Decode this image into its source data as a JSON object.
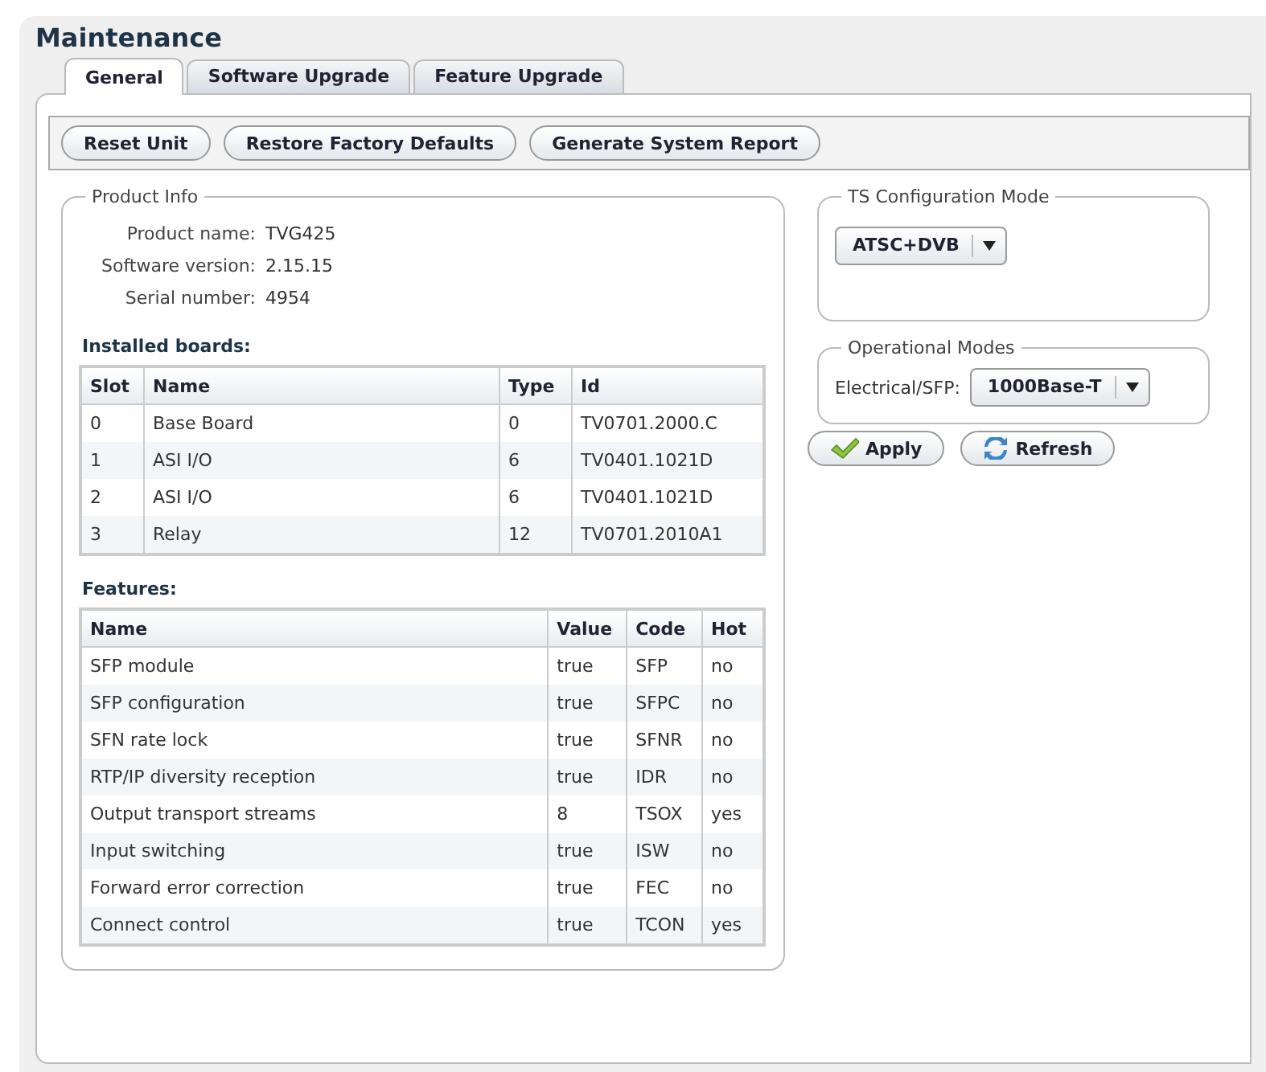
{
  "title": "Maintenance",
  "tabs": [
    {
      "label": "General",
      "selected": true
    },
    {
      "label": "Software Upgrade",
      "selected": false
    },
    {
      "label": "Feature Upgrade",
      "selected": false
    }
  ],
  "toolbar": [
    "Reset Unit",
    "Restore Factory Defaults",
    "Generate System Report"
  ],
  "product_info": {
    "legend": "Product Info",
    "fields": [
      {
        "label": "Product name:",
        "value": "TVG425"
      },
      {
        "label": "Software version:",
        "value": "2.15.15"
      },
      {
        "label": "Serial number:",
        "value": "4954"
      }
    ],
    "boards": {
      "heading": "Installed boards:",
      "columns": [
        "Slot",
        "Name",
        "Type",
        "Id"
      ],
      "rows": [
        [
          "0",
          "Base Board",
          "0",
          "TV0701.2000.C"
        ],
        [
          "1",
          "ASI I/O",
          "6",
          "TV0401.1021D"
        ],
        [
          "2",
          "ASI I/O",
          "6",
          "TV0401.1021D"
        ],
        [
          "3",
          "Relay",
          "12",
          "TV0701.2010A1"
        ]
      ]
    },
    "features": {
      "heading": "Features:",
      "columns": [
        "Name",
        "Value",
        "Code",
        "Hot"
      ],
      "rows": [
        [
          "SFP module",
          "true",
          "SFP",
          "no"
        ],
        [
          "SFP configuration",
          "true",
          "SFPC",
          "no"
        ],
        [
          "SFN rate lock",
          "true",
          "SFNR",
          "no"
        ],
        [
          "RTP/IP diversity reception",
          "true",
          "IDR",
          "no"
        ],
        [
          "Output transport streams",
          "8",
          "TSOX",
          "yes"
        ],
        [
          "Input switching",
          "true",
          "ISW",
          "no"
        ],
        [
          "Forward error correction",
          "true",
          "FEC",
          "no"
        ],
        [
          "Connect control",
          "true",
          "TCON",
          "yes"
        ]
      ]
    }
  },
  "ts_configuration": {
    "legend": "TS Configuration Mode",
    "value": "ATSC+DVB"
  },
  "operational_modes": {
    "legend": "Operational Modes",
    "label": "Electrical/SFP:",
    "value": "1000Base-T"
  },
  "actions": [
    {
      "label": "Apply",
      "kind": "apply"
    },
    {
      "label": "Refresh",
      "kind": "refresh"
    }
  ]
}
